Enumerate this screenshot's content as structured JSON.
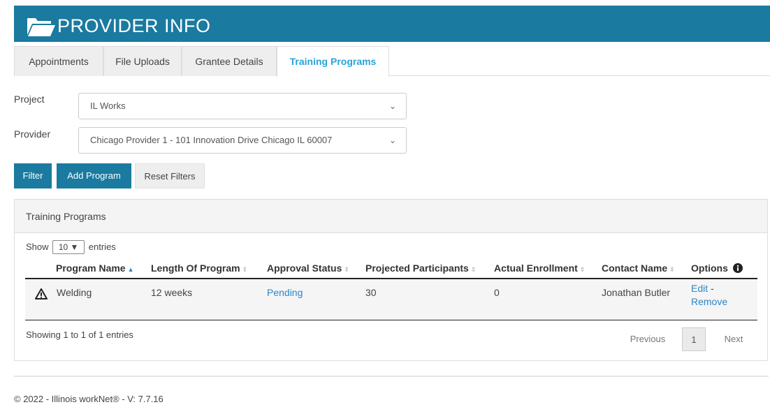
{
  "header": {
    "title": "PROVIDER INFO",
    "icon": "folder-open-icon",
    "color": "#1a7aa0"
  },
  "tabs": [
    {
      "label": "Appointments",
      "active": false
    },
    {
      "label": "File Uploads",
      "active": false
    },
    {
      "label": "Grantee Details",
      "active": false
    },
    {
      "label": "Training Programs",
      "active": true
    }
  ],
  "filters": {
    "project_label": "Project",
    "project_value": "IL Works",
    "provider_label": "Provider",
    "provider_value": "Chicago Provider 1 - 101 Innovation Drive Chicago IL 60007"
  },
  "buttons": {
    "filter": "Filter",
    "add_program": "Add Program",
    "reset_filters": "Reset Filters"
  },
  "panel": {
    "title": "Training Programs",
    "show_prefix": "Show",
    "show_value": "10",
    "show_suffix": "entries",
    "columns": [
      "Program Name",
      "Length Of Program",
      "Approval Status",
      "Projected Participants",
      "Actual Enrollment",
      "Contact Name",
      "Options"
    ],
    "rows": [
      {
        "warning_icon": "warning-icon",
        "program_name": "Welding",
        "length": "12 weeks",
        "approval_status": "Pending",
        "projected": "30",
        "actual": "0",
        "contact": "Jonathan Butler",
        "edit": "Edit",
        "separator": "-",
        "remove": "Remove"
      }
    ],
    "info": "Showing 1 to 1 of 1 entries",
    "pagination": {
      "previous": "Previous",
      "current": "1",
      "next": "Next"
    }
  },
  "footer": {
    "text": "© 2022 - Illinois workNet® - V: 7.7.16"
  }
}
